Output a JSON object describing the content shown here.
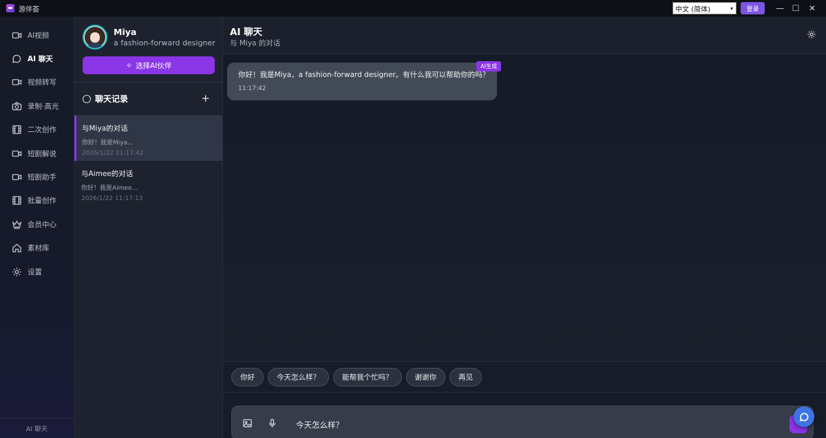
{
  "titlebar": {
    "app_name": "游伴荟",
    "language": "中文 (简体)",
    "login_label": "登录",
    "minimize": "—",
    "maximize": "☐",
    "close": "✕"
  },
  "nav": {
    "items": [
      {
        "label": "AI视频",
        "icon": "video-camera-icon"
      },
      {
        "label": "AI 聊天",
        "icon": "chat-bubble-icon",
        "active": true
      },
      {
        "label": "视频转写",
        "icon": "video-camera-icon"
      },
      {
        "label": "录制·高光",
        "icon": "camera-icon"
      },
      {
        "label": "二次创作",
        "icon": "film-strip-icon"
      },
      {
        "label": "短剧解说",
        "icon": "video-camera-icon"
      },
      {
        "label": "短剧助手",
        "icon": "video-camera-icon"
      },
      {
        "label": "批量创作",
        "icon": "film-strip-icon"
      },
      {
        "label": "会员中心",
        "icon": "crown-icon"
      },
      {
        "label": "素材库",
        "icon": "home-icon"
      },
      {
        "label": "设置",
        "icon": "gear-icon"
      }
    ],
    "footer": "AI 聊天"
  },
  "profile": {
    "name": "Miya",
    "description": "a fashion-forward designer",
    "pick_button": "选择AI伙伴"
  },
  "history": {
    "title": "聊天记录",
    "add": "+",
    "conversations": [
      {
        "title": "与Miya的对话",
        "preview": "你好！我是Miya...",
        "time": "2026/1/22 11:17:42"
      },
      {
        "title": "与Aimee的对话",
        "preview": "你好！我是Aimee...",
        "time": "2026/1/22 11:17:13"
      }
    ]
  },
  "chat": {
    "title": "AI 聊天",
    "subtitle": "与 Miya 的对话",
    "messages": [
      {
        "text": "你好！我是Miya，a fashion-forward designer。有什么我可以帮助你的吗？",
        "time": "11:17:42",
        "badge": "AI生成"
      }
    ],
    "quick_replies": [
      "你好",
      "今天怎么样？",
      "能帮我个忙吗？",
      "谢谢你",
      "再见"
    ],
    "input_value": "今天怎么样？"
  },
  "colors": {
    "accent": "#8a35e6",
    "login": "#7b55e0",
    "float_button": "#3d74e6"
  }
}
